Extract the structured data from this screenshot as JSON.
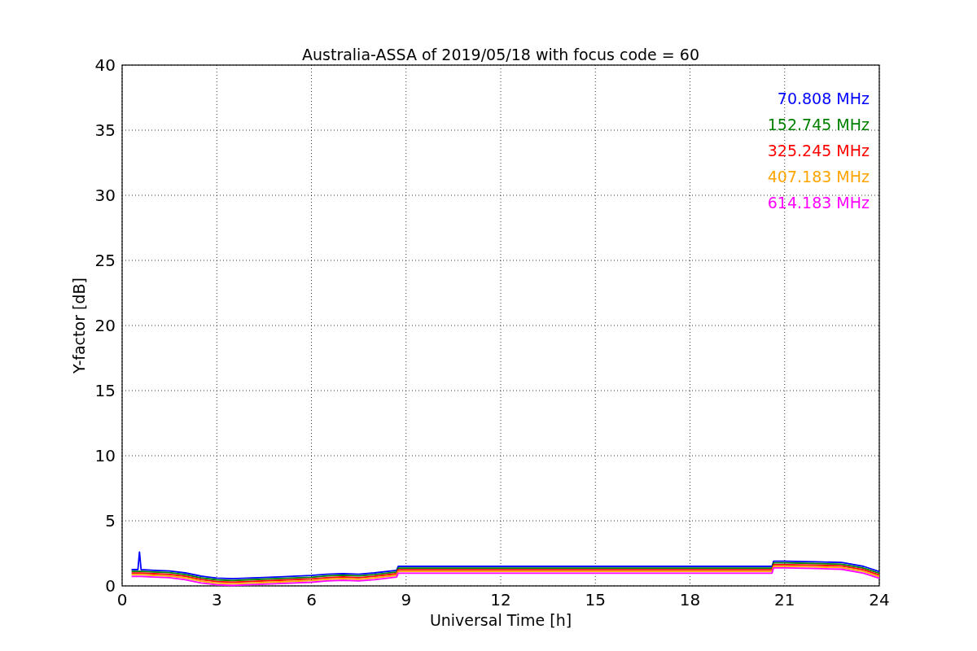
{
  "chart_data": {
    "type": "line",
    "title": "Australia-ASSA of 2019/05/18 with focus code = 60",
    "xlabel": "Universal Time [h]",
    "ylabel": "Y-factor [dB]",
    "x": [
      0.3,
      0.5,
      0.55,
      0.6,
      1,
      1.5,
      2,
      2.5,
      3,
      3.5,
      4,
      5,
      6,
      6.5,
      7,
      7.5,
      8,
      8.7,
      8.75,
      12,
      15,
      18,
      20.6,
      20.65,
      21,
      22,
      22.8,
      23.5,
      24
    ],
    "series": [
      {
        "name": "70.808 MHz",
        "color": "#0000ff",
        "values": [
          1.25,
          1.25,
          2.6,
          1.25,
          1.2,
          1.15,
          1.0,
          0.75,
          0.6,
          0.55,
          0.6,
          0.7,
          0.8,
          0.9,
          0.95,
          0.9,
          1.0,
          1.2,
          1.5,
          1.5,
          1.5,
          1.5,
          1.5,
          1.9,
          1.9,
          1.85,
          1.8,
          1.5,
          1.1
        ]
      },
      {
        "name": "152.745 MHz",
        "color": "#008000",
        "values": [
          1.12,
          1.12,
          1.12,
          1.12,
          1.07,
          1.02,
          0.87,
          0.62,
          0.47,
          0.42,
          0.47,
          0.57,
          0.67,
          0.77,
          0.82,
          0.77,
          0.87,
          1.07,
          1.37,
          1.37,
          1.37,
          1.37,
          1.37,
          1.77,
          1.77,
          1.72,
          1.67,
          1.37,
          0.97
        ]
      },
      {
        "name": "325.245 MHz",
        "color": "#ff0000",
        "values": [
          0.99,
          0.99,
          0.99,
          0.99,
          0.94,
          0.89,
          0.74,
          0.49,
          0.34,
          0.29,
          0.34,
          0.44,
          0.54,
          0.64,
          0.69,
          0.64,
          0.74,
          0.94,
          1.24,
          1.24,
          1.24,
          1.24,
          1.24,
          1.64,
          1.64,
          1.59,
          1.54,
          1.24,
          0.84
        ]
      },
      {
        "name": "407.183 MHz",
        "color": "#ffa500",
        "values": [
          0.86,
          0.86,
          0.86,
          0.86,
          0.81,
          0.76,
          0.61,
          0.36,
          0.21,
          0.16,
          0.21,
          0.31,
          0.41,
          0.51,
          0.56,
          0.51,
          0.61,
          0.81,
          1.11,
          1.11,
          1.11,
          1.11,
          1.11,
          1.51,
          1.51,
          1.46,
          1.41,
          1.11,
          0.71
        ]
      },
      {
        "name": "614.183 MHz",
        "color": "#ff00ff",
        "values": [
          0.73,
          0.73,
          0.73,
          0.73,
          0.68,
          0.63,
          0.48,
          0.23,
          0.08,
          0.03,
          0.08,
          0.18,
          0.28,
          0.38,
          0.43,
          0.38,
          0.48,
          0.68,
          0.98,
          0.98,
          0.98,
          0.98,
          0.98,
          1.38,
          1.38,
          1.33,
          1.28,
          0.98,
          0.58
        ]
      }
    ],
    "grid": true,
    "xlim": [
      0,
      24
    ],
    "ylim": [
      0,
      40
    ],
    "xticks": [
      0,
      3,
      6,
      9,
      12,
      15,
      18,
      21,
      24
    ],
    "yticks": [
      0,
      5,
      10,
      15,
      20,
      25,
      30,
      35,
      40
    ]
  }
}
